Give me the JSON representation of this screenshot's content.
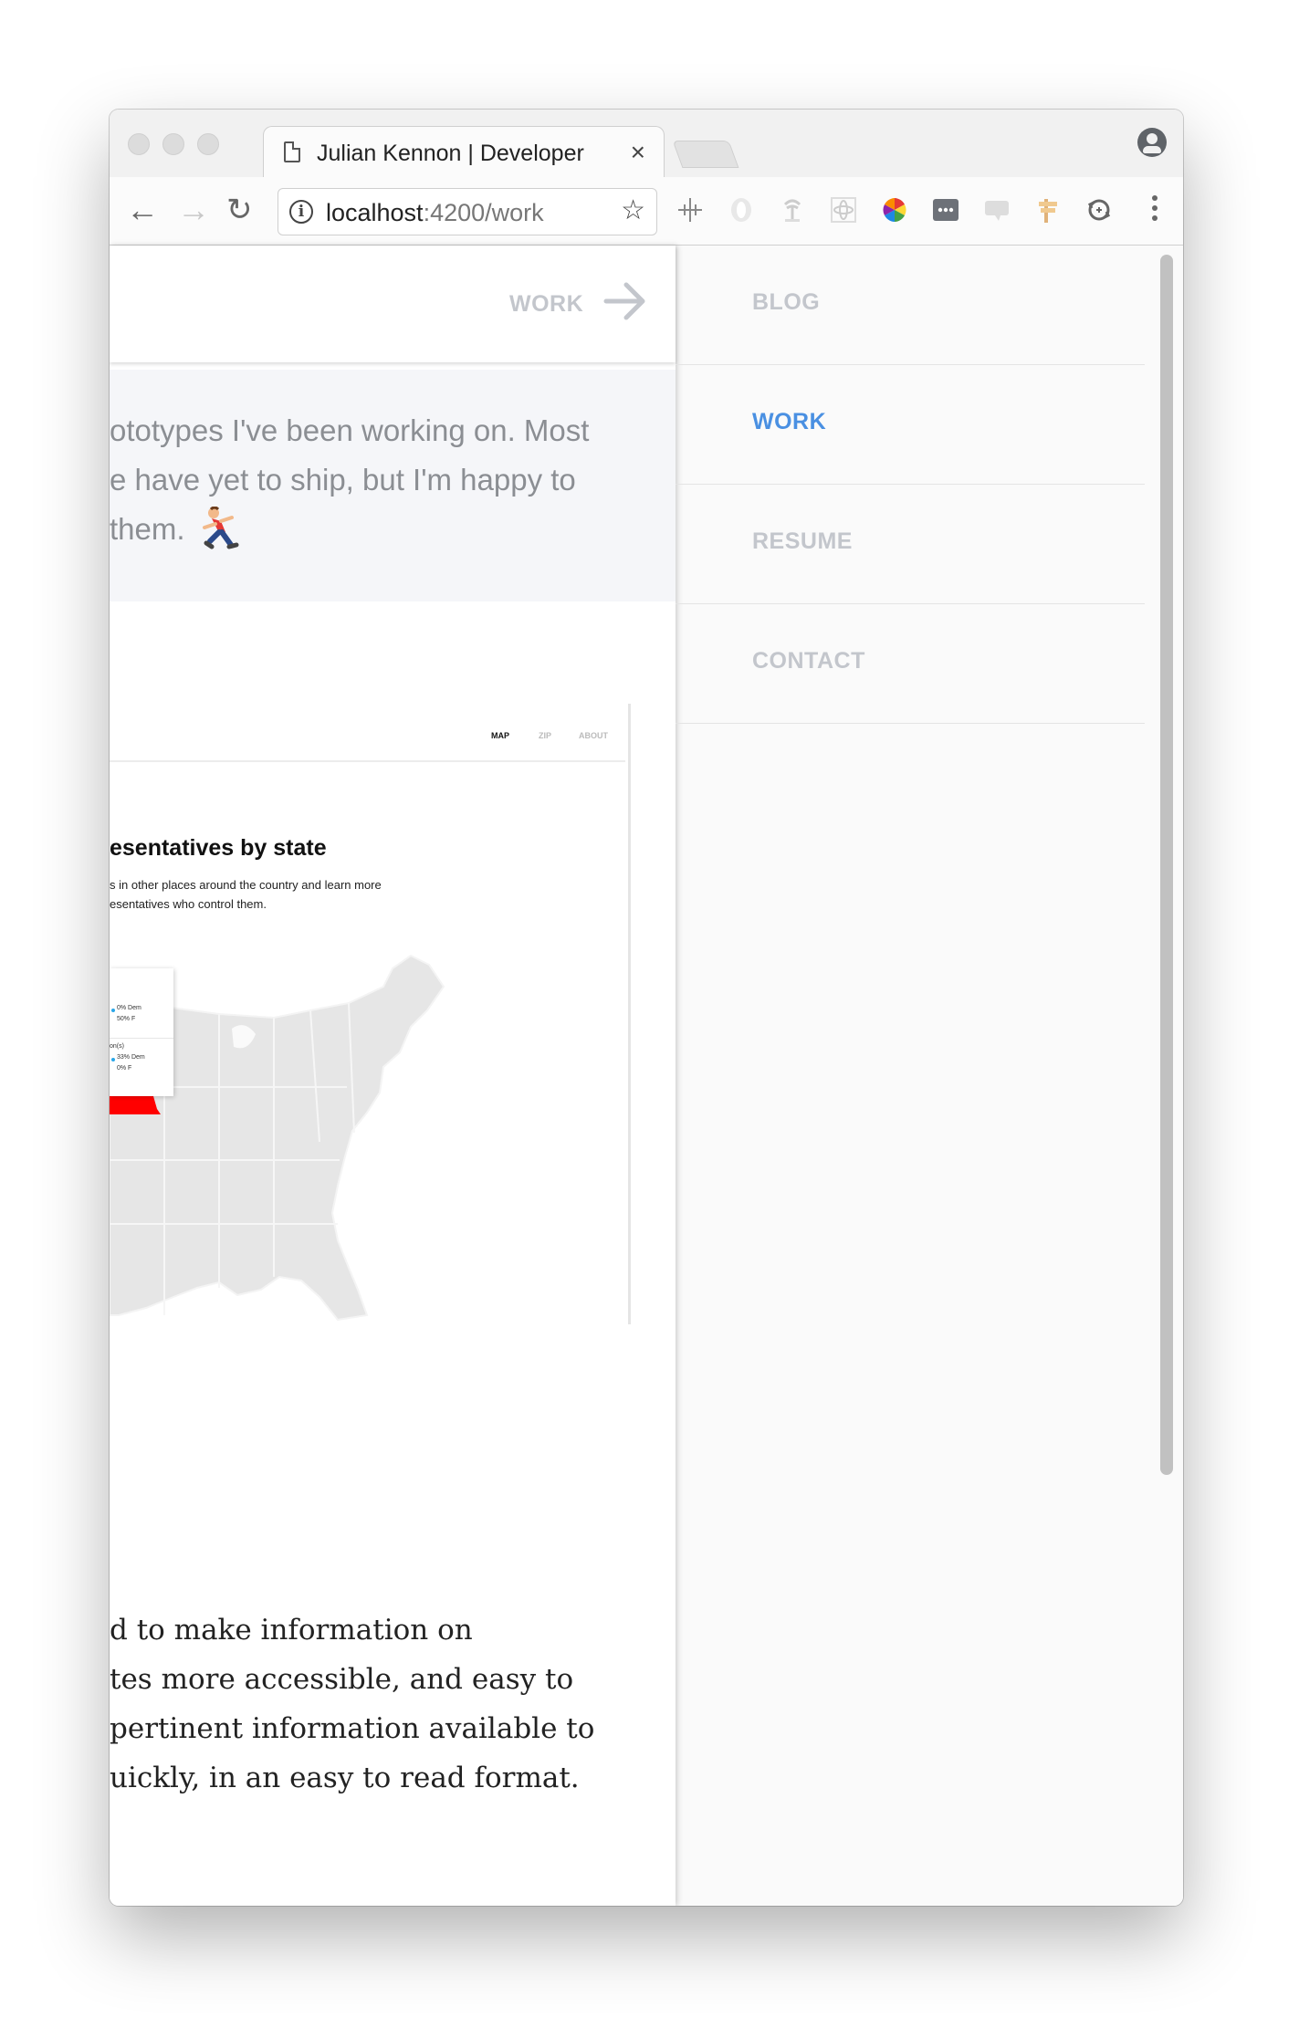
{
  "browser": {
    "tab_title": "Julian Kennon | Developer",
    "tab_close": "×",
    "url_host": "localhost",
    "url_path": ":4200/work"
  },
  "page": {
    "header_link": "WORK",
    "intro_lines": [
      "ototypes I've been working on. Most",
      "e have yet to ship, but I'm happy to",
      "them."
    ],
    "project_screenshot": {
      "nav": [
        "MAP",
        "ZIP",
        "ABOUT"
      ],
      "title": "esentatives by state",
      "description": [
        "s in other places around the country and learn more",
        "esentatives who control them."
      ],
      "legend": [
        "0% Dem",
        "50% F",
        "on(s)",
        "33% Dem",
        "0% F"
      ],
      "highlight_color": "#ff0000"
    },
    "description_lines": [
      "d to make information on",
      "tes more accessible, and easy to",
      "pertinent information available to",
      "uickly, in an easy to read format."
    ]
  },
  "menu": {
    "items": [
      {
        "label": "BLOG",
        "active": false
      },
      {
        "label": "WORK",
        "active": true
      },
      {
        "label": "RESUME",
        "active": false
      },
      {
        "label": "CONTACT",
        "active": false
      }
    ],
    "active_color": "#4a90e2",
    "inactive_color": "#c3c6cc"
  },
  "extensions": [
    "move-icon",
    "opera-icon",
    "palm-tree-icon",
    "react-devtools-icon",
    "color-wheel-icon",
    "more-icon",
    "css-icon",
    "signpost-icon",
    "sync-icon"
  ]
}
